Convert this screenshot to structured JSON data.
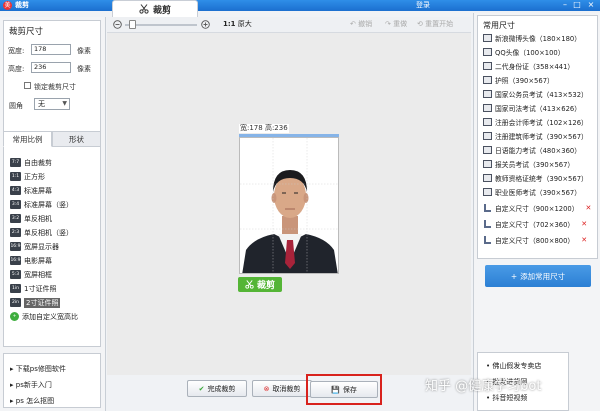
{
  "titlebar": {
    "app_icon": "美",
    "title": "裁剪",
    "login": "登录"
  },
  "tab": {
    "label": "裁剪"
  },
  "toolbar": {
    "zoom_label": "1:1",
    "zoom_text": "原大",
    "undo": "撤销",
    "redo": "重做",
    "reset": "重置开始"
  },
  "crop_size": {
    "heading": "裁剪尺寸",
    "width_label": "宽度:",
    "width_value": "178",
    "width_unit": "像素",
    "height_label": "高度:",
    "height_value": "236",
    "height_unit": "像素",
    "lock_label": "锁定裁剪尺寸",
    "corner_label": "圆角",
    "corner_value": "无"
  },
  "tabs": [
    {
      "label": "常用比例"
    },
    {
      "label": "形状"
    }
  ],
  "ratio_items": [
    {
      "icon": "7:7",
      "label": "自由裁剪"
    },
    {
      "icon": "1:1",
      "label": "正方形"
    },
    {
      "icon": "4:3",
      "label": "标准屏幕"
    },
    {
      "icon": "3:4",
      "label": "标准屏幕（竖）"
    },
    {
      "icon": "3:2",
      "label": "单反相机"
    },
    {
      "icon": "2:3",
      "label": "单反相机（竖）"
    },
    {
      "icon": "16:9",
      "label": "宽屏显示器"
    },
    {
      "icon": "16:9",
      "label": "电影屏幕"
    },
    {
      "icon": "5:3",
      "label": "宽屏相框"
    },
    {
      "icon": "1in",
      "label": "1寸证件照"
    },
    {
      "icon": "2in",
      "label": "2寸证件照"
    },
    {
      "icon": "+",
      "label": "添加自定义宽高比"
    }
  ],
  "links": [
    "下载ps修图软件",
    "ps新手入门",
    "ps 怎么抠图"
  ],
  "canvas": {
    "size_info": "宽:178 高:236",
    "crop_confirm": "裁剪"
  },
  "bottom_buttons": {
    "done": "完成裁剪",
    "cancel": "取消裁剪",
    "save": "保存"
  },
  "common_sizes": {
    "heading": "常用尺寸",
    "items": [
      {
        "label": "新浪微博头像（180×180）",
        "custom": false
      },
      {
        "label": "QQ头像（100×100）",
        "custom": false
      },
      {
        "label": "二代身份证（358×441）",
        "custom": false
      },
      {
        "label": "护照（390×567）",
        "custom": false
      },
      {
        "label": "国家公务员考试（413×532）",
        "custom": false
      },
      {
        "label": "国家司法考试（413×626）",
        "custom": false
      },
      {
        "label": "注册会计师考试（102×126）",
        "custom": false
      },
      {
        "label": "注册建筑师考试（390×567）",
        "custom": false
      },
      {
        "label": "日语能力考试（480×360）",
        "custom": false
      },
      {
        "label": "报关员考试（390×567）",
        "custom": false
      },
      {
        "label": "教师资格证统考（390×567）",
        "custom": false
      },
      {
        "label": "职业医师考试（390×567）",
        "custom": false
      },
      {
        "label": "自定义尺寸（900×1200）",
        "custom": true
      },
      {
        "label": "自定义尺寸（702×360）",
        "custom": true
      },
      {
        "label": "自定义尺寸（800×800）",
        "custom": true
      }
    ],
    "add_label": "添加常用尺寸"
  },
  "shop": {
    "items": [
      "佛山假发专卖店",
      "批发进货网",
      "抖音短视频"
    ]
  },
  "watermark": "知乎 @健康学习bot",
  "colors": {
    "accent": "#2b7fd4",
    "confirm_green": "#54b536",
    "highlight_red": "#d8221d"
  }
}
